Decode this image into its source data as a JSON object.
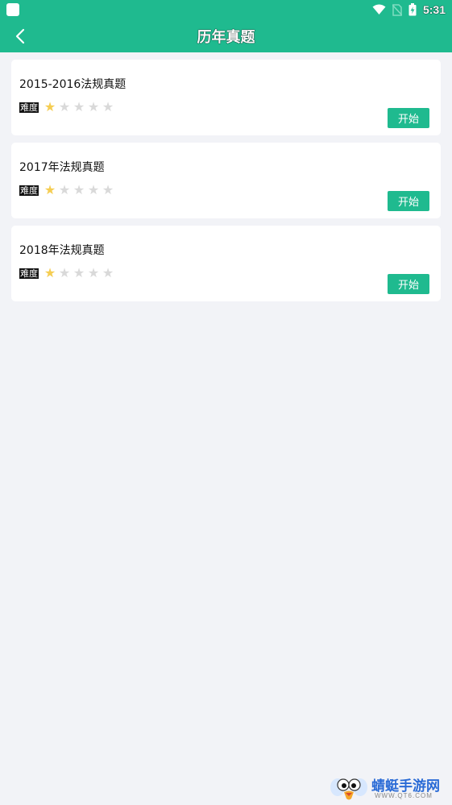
{
  "status_bar": {
    "time": "5:31",
    "icons": [
      "notification-icon",
      "wifi-icon",
      "no-sim-icon",
      "battery-charging-icon"
    ]
  },
  "header": {
    "title": "历年真题",
    "back_icon": "chevron-left-icon"
  },
  "exams": [
    {
      "title": "2015-2016法规真题",
      "difficulty_label": "难度",
      "rating": 1,
      "max_rating": 5,
      "button": "开始"
    },
    {
      "title": "2017年法规真题",
      "difficulty_label": "难度",
      "rating": 1,
      "max_rating": 5,
      "button": "开始"
    },
    {
      "title": "2018年法规真题",
      "difficulty_label": "难度",
      "rating": 1,
      "max_rating": 5,
      "button": "开始"
    }
  ],
  "watermark": {
    "text": "蜻蜓手游网",
    "url": "WWW.QT6.COM"
  },
  "colors": {
    "primary": "#1fba8f",
    "background": "#f2f3f7",
    "star_on": "#f5cd52",
    "star_off": "#d9d9d9"
  }
}
